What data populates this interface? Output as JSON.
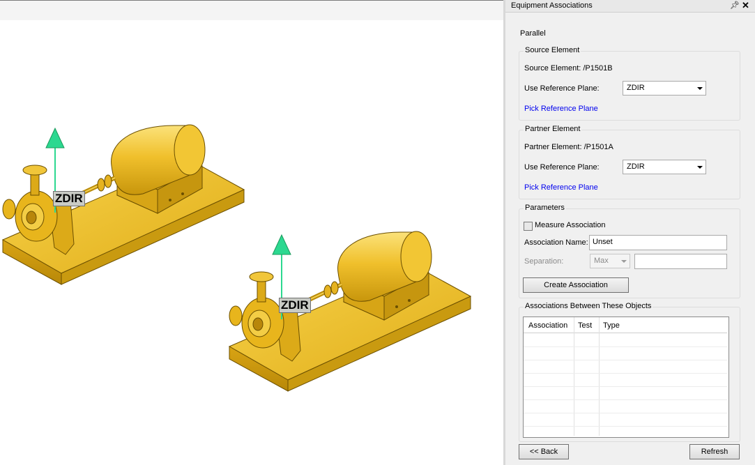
{
  "viewport": {
    "labels": [
      "ZDIR",
      "ZDIR"
    ],
    "colors": {
      "equipment": "#e8b51c",
      "axis": "#2cd890"
    }
  },
  "panel": {
    "title": "Equipment Associations",
    "pin_icon": "pin-icon",
    "close_icon": "close-icon",
    "mode": "Parallel",
    "source": {
      "legend": "Source Element",
      "element_text": "Source Element:  /P1501B",
      "plane_label": "Use Reference Plane:",
      "plane_value": "ZDIR",
      "pick_link": "Pick Reference Plane"
    },
    "partner": {
      "legend": "Partner Element",
      "element_text": "Partner Element: /P1501A",
      "plane_label": "Use Reference Plane:",
      "plane_value": "ZDIR",
      "pick_link": "Pick Reference Plane"
    },
    "parameters": {
      "legend": "Parameters",
      "measure_label": "Measure Association",
      "measure_checked": false,
      "name_label": "Association Name:",
      "name_value": "Unset",
      "separation_label": "Separation:",
      "separation_select": "Max",
      "separation_value": "",
      "create_button": "Create Association"
    },
    "associations": {
      "legend": "Associations Between These Objects",
      "columns": [
        "Association",
        "Test",
        "Type"
      ],
      "rows": []
    },
    "back_button": "<< Back",
    "refresh_button": "Refresh"
  }
}
